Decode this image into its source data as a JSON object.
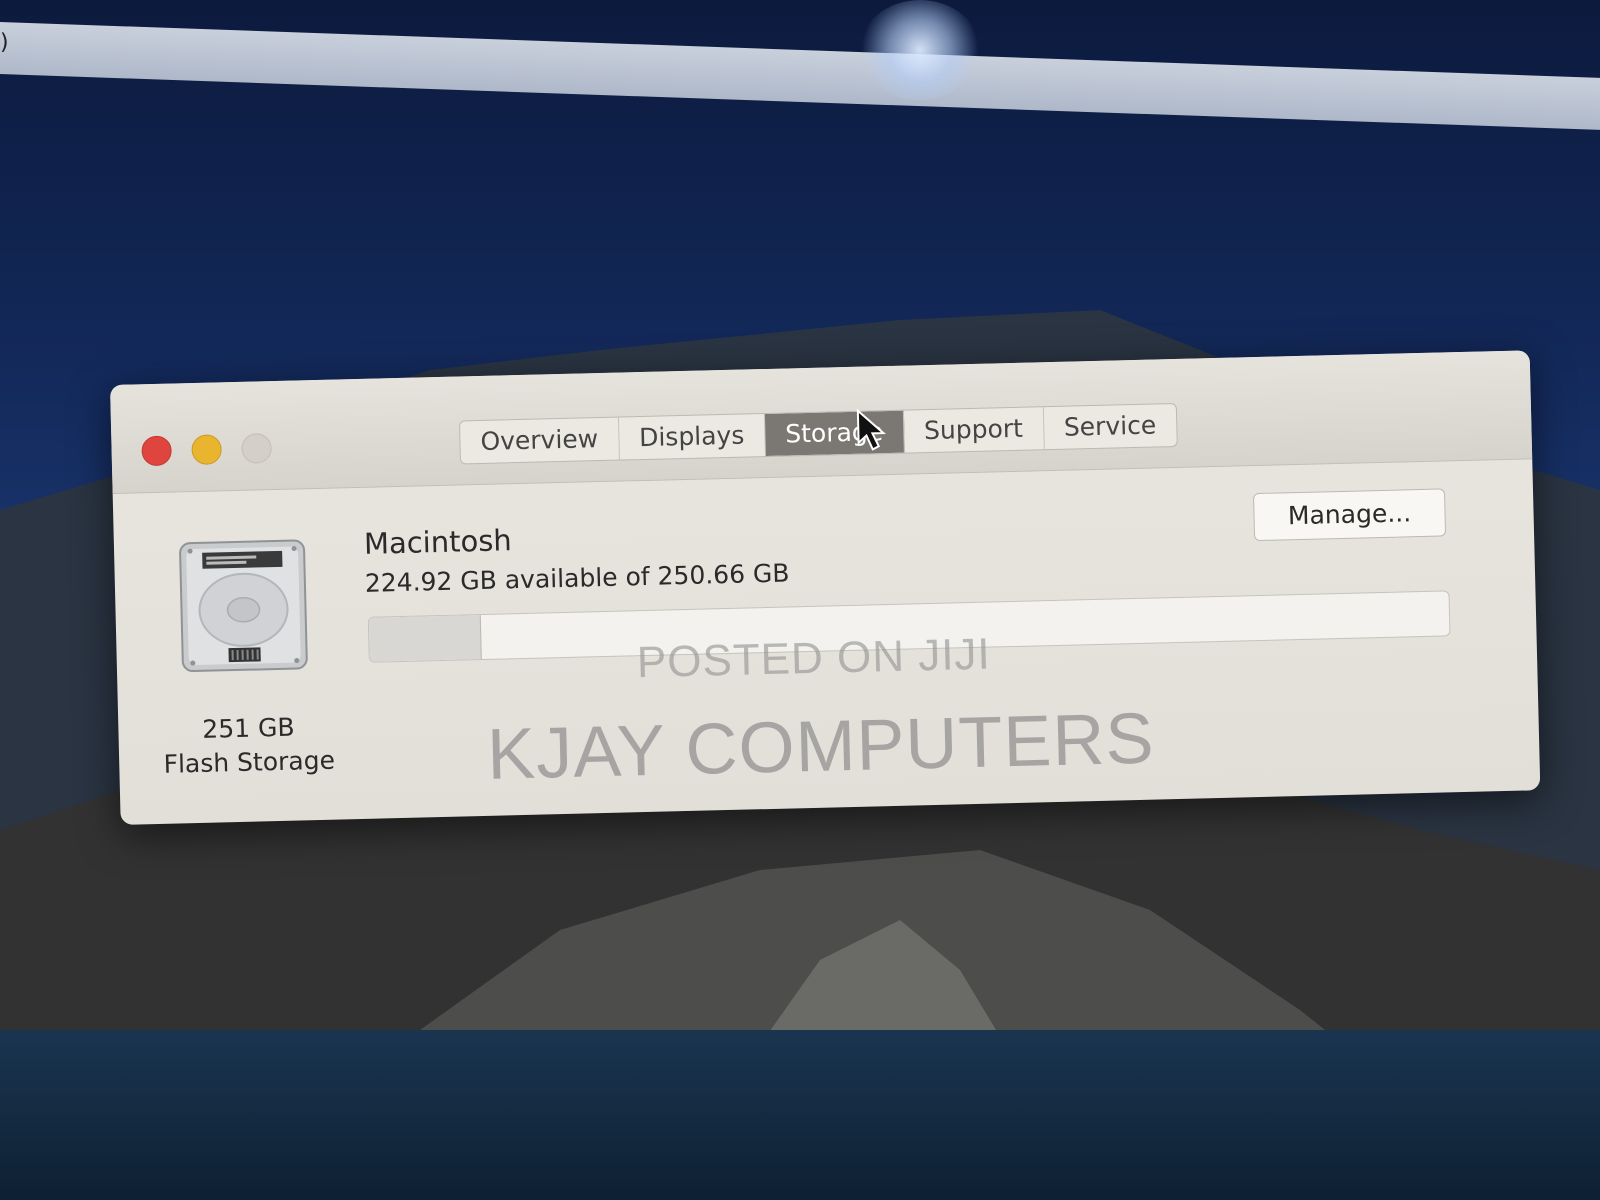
{
  "window": {
    "tabs": [
      {
        "label": "Overview",
        "selected": false
      },
      {
        "label": "Displays",
        "selected": false
      },
      {
        "label": "Storage",
        "selected": true
      },
      {
        "label": "Support",
        "selected": false
      },
      {
        "label": "Service",
        "selected": false
      }
    ],
    "traffic_lights": {
      "close_color": "#e0443e",
      "minimize_color": "#e9b52f",
      "zoom_color": "#d4d0c9"
    }
  },
  "storage": {
    "disk_size": "251 GB",
    "disk_type": "Flash Storage",
    "volume_name": "Macintosh",
    "availability_text": "224.92 GB available of 250.66 GB",
    "used_fraction": 0.103,
    "manage_label": "Manage..."
  },
  "watermark": {
    "line1": "POSTED ON JIJI",
    "line2": "KJAY COMPUTERS"
  },
  "icons": {
    "disk": "hard-drive-icon",
    "cursor": "mouse-pointer-icon"
  }
}
